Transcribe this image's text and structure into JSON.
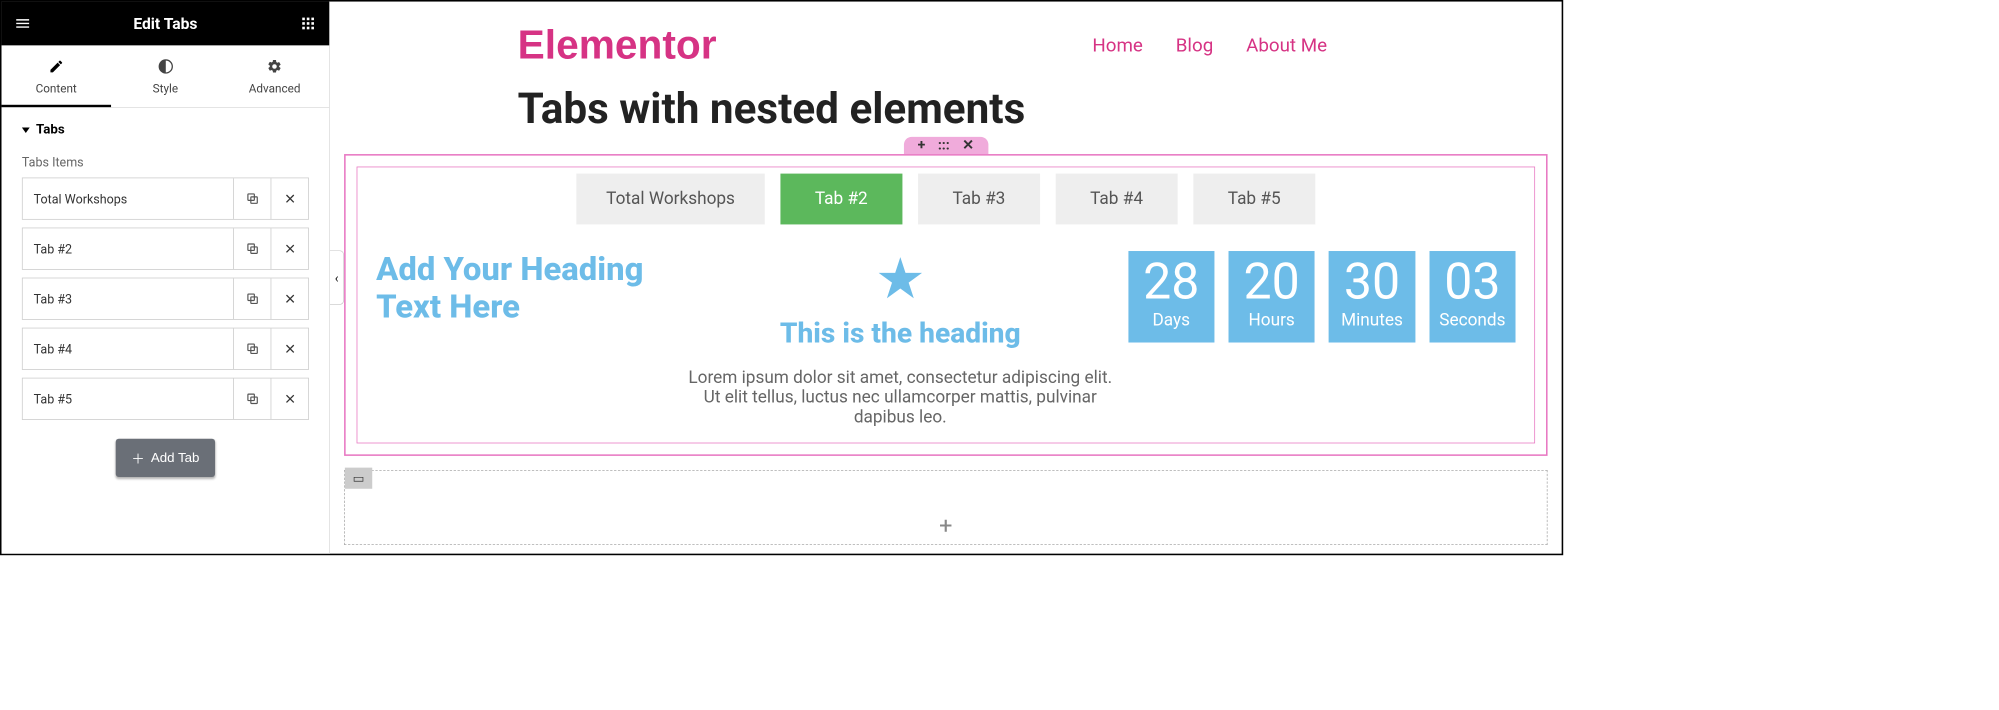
{
  "panel": {
    "title": "Edit Tabs",
    "modeTabs": {
      "content": "Content",
      "style": "Style",
      "advanced": "Advanced"
    },
    "section": {
      "title": "Tabs",
      "fieldLabel": "Tabs Items"
    },
    "items": [
      {
        "label": "Total Workshops"
      },
      {
        "label": "Tab #2"
      },
      {
        "label": "Tab #3"
      },
      {
        "label": "Tab #4"
      },
      {
        "label": "Tab #5"
      }
    ],
    "addBtn": "Add Tab"
  },
  "site": {
    "logo": "Elementor",
    "nav": [
      "Home",
      "Blog",
      "About Me"
    ],
    "pageTitle": "Tabs with nested elements"
  },
  "tabs": {
    "items": [
      {
        "label": "Total Workshops",
        "active": false
      },
      {
        "label": "Tab #2",
        "active": true
      },
      {
        "label": "Tab #3",
        "active": false
      },
      {
        "label": "Tab #4",
        "active": false
      },
      {
        "label": "Tab #5",
        "active": false
      }
    ]
  },
  "content": {
    "heading": "Add Your Heading Text Here",
    "iconboxTitle": "This is the heading",
    "iconboxDesc": "Lorem ipsum dolor sit amet, consectetur adipiscing elit. Ut elit tellus, luctus nec ullamcorper mattis, pulvinar dapibus leo.",
    "countdown": [
      {
        "value": "28",
        "label": "Days"
      },
      {
        "value": "20",
        "label": "Hours"
      },
      {
        "value": "30",
        "label": "Minutes"
      },
      {
        "value": "03",
        "label": "Seconds"
      }
    ]
  },
  "glyphs": {
    "plus": "+",
    "dots": ":::",
    "close": "✕",
    "chevronLeft": "‹",
    "plusSmall": "＋",
    "star": "★",
    "columns": "▭"
  }
}
